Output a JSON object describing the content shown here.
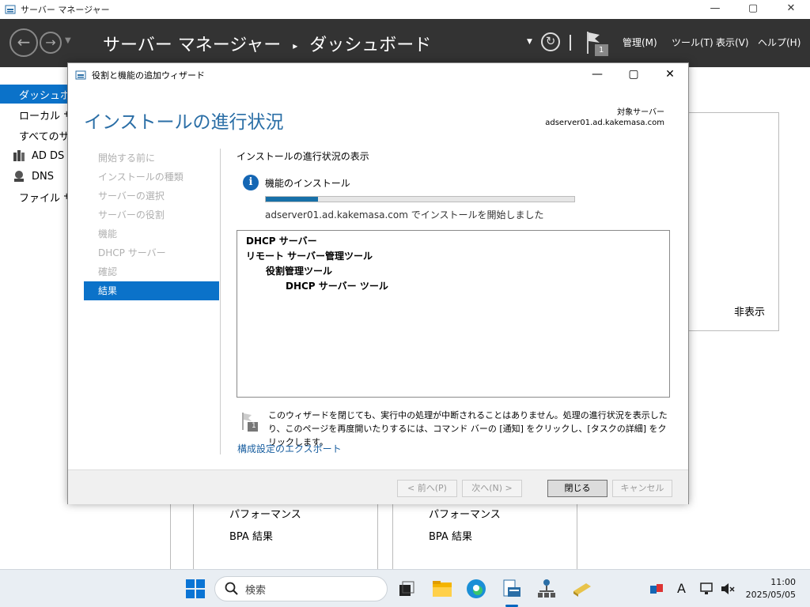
{
  "app": {
    "title": "サーバー マネージャー",
    "minimize": "—",
    "maximize": "▢",
    "close": "✕"
  },
  "header": {
    "breadcrumb_root": "サーバー マネージャー",
    "breadcrumb_sep": "▸",
    "breadcrumb_current": "ダッシュボード",
    "notification_count": "1",
    "menus": [
      "管理(M)",
      "ツール(T)",
      "表示(V)",
      "ヘルプ(H)"
    ]
  },
  "nav": {
    "items": [
      {
        "label": "ダッシュボード",
        "icon": "dashboard-icon"
      },
      {
        "label": "ローカル サーバー",
        "icon": "server-icon"
      },
      {
        "label": "すべてのサーバー",
        "icon": "servers-icon"
      },
      {
        "label": "AD DS",
        "icon": "ad-ds-icon"
      },
      {
        "label": "DNS",
        "icon": "dns-icon"
      },
      {
        "label": "ファイル サービスと記憶域サービス",
        "icon": "file-services-icon"
      }
    ]
  },
  "dashboard": {
    "hide_label": "非表示",
    "tiles": [
      {
        "perf": "パフォーマンス",
        "bpa": "BPA 結果"
      },
      {
        "perf": "パフォーマンス",
        "bpa": "BPA 結果"
      }
    ]
  },
  "dialog": {
    "title": "役割と機能の追加ウィザード",
    "heading": "インストールの進行状況",
    "target_label": "対象サーバー",
    "target_server": "adserver01.ad.kakemasa.com",
    "steps": [
      {
        "label": "開始する前に",
        "active": false
      },
      {
        "label": "インストールの種類",
        "active": false
      },
      {
        "label": "サーバーの選択",
        "active": false
      },
      {
        "label": "サーバーの役割",
        "active": false
      },
      {
        "label": "機能",
        "active": false
      },
      {
        "label": "DHCP サーバー",
        "active": false
      },
      {
        "label": "確認",
        "active": false
      },
      {
        "label": "結果",
        "active": true
      }
    ],
    "content_title": "インストールの進行状況の表示",
    "feature_install": "機能のインストール",
    "progress_fraction": 0.17,
    "install_status": "adserver01.ad.kakemasa.com でインストールを開始しました",
    "features": [
      {
        "label": "DHCP サーバー",
        "level": 0
      },
      {
        "label": "リモート サーバー管理ツール",
        "level": 0
      },
      {
        "label": "役割管理ツール",
        "level": 1
      },
      {
        "label": "DHCP サーバー ツール",
        "level": 2
      }
    ],
    "notice_count": "1",
    "notice": "このウィザードを閉じても、実行中の処理が中断されることはありません。処理の進行状況を表示したり、このページを再度開いたりするには、コマンド バーの [通知] をクリックし、[タスクの詳細] をクリックします。",
    "export_link": "構成設定のエクスポート",
    "buttons": {
      "prev": "< 前へ(P)",
      "next": "次へ(N) >",
      "close": "閉じる",
      "cancel": "キャンセル"
    }
  },
  "taskbar": {
    "search_placeholder": "検索",
    "time": "11:00",
    "date": "2025/05/05",
    "ime": "A"
  },
  "colors": {
    "accent": "#0b72c9",
    "header_bg": "#333333",
    "heading_blue": "#2a6ea6",
    "progress": "#1770a8"
  }
}
